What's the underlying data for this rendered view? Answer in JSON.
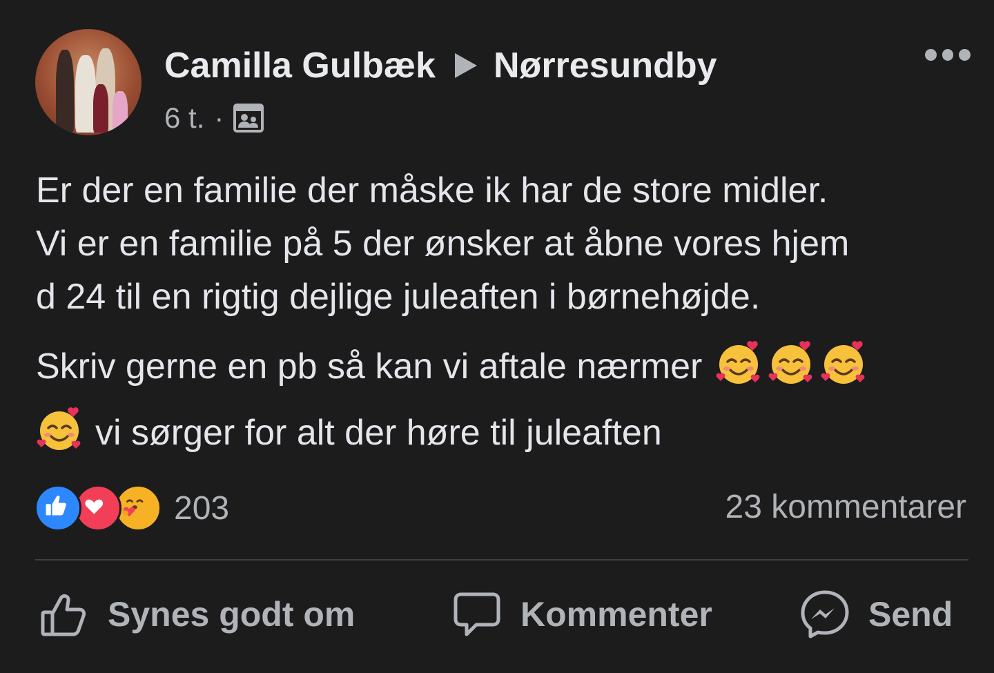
{
  "post": {
    "author": "Camilla Gulbæk",
    "group": "Nørresundby",
    "timestamp": "6 t.",
    "separator": "·",
    "audience_icon": "group-icon",
    "body": {
      "line1": "Er der en familie der måske ik har de store midler.",
      "line2": "Vi er en familie på 5 der ønsker at åbne vores hjem",
      "line3": "d 24 til en rigtig dejlige juleaften i børnehøjde.",
      "line4": "Skriv gerne en pb så kan vi aftale nærmer",
      "line5": "vi sørger for alt der høre til juleaften",
      "emoji": "smiling-face-with-hearts"
    },
    "reaction_count": "203",
    "comments_count": "23 kommentarer",
    "actions": {
      "like": "Synes godt om",
      "comment": "Kommenter",
      "send": "Send"
    },
    "colors": {
      "background": "#1c1c1d",
      "text_primary": "#e4e6eb",
      "text_secondary": "#b0b3b8",
      "like_blue": "#2d88ff",
      "love_red": "#f33e58",
      "care_yellow": "#f7b125"
    }
  }
}
